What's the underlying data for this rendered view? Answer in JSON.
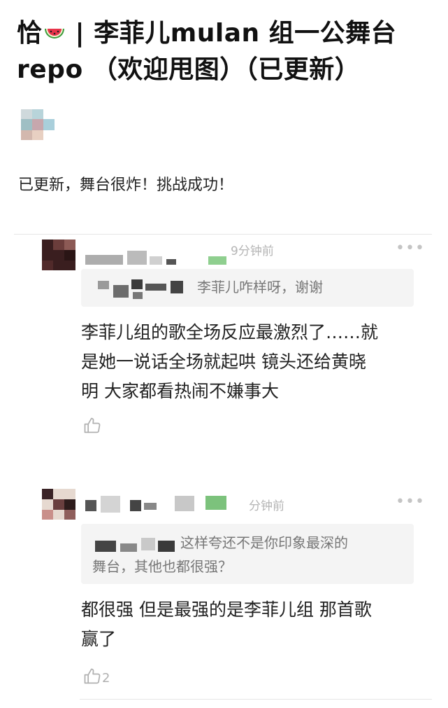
{
  "post": {
    "title": "恰🍉 | 李菲儿mulan 组一公舞台repo （欢迎甩图）（已更新）",
    "title_line1_prefix": "恰",
    "title_line1_rest": " | 李菲儿mulan 组一公舞台",
    "title_line2": "repo （欢迎甩图）（已更新）",
    "body": "已更新，舞台很炸！挑战成功！"
  },
  "comments": [
    {
      "time": "9分钟前",
      "quote": "李菲儿咋样呀，谢谢",
      "body_lines": [
        "李菲儿组的歌全场反应最激烈了……就",
        "是她一说话全场就起哄 镜头还给黄晓",
        "明 大家都看热闹不嫌事大"
      ],
      "likes": ""
    },
    {
      "time": "分钟前",
      "quote_line1": "这样夸还不是你印象最深的",
      "quote_line2": "舞台，其他也都很强？",
      "body_lines": [
        "都很强 但是最强的是李菲儿组 那首歌",
        "赢了"
      ],
      "likes": "2"
    }
  ],
  "icons": {
    "more": "more-dots-icon",
    "like": "thumbs-up-icon",
    "emoji": "watermelon-icon"
  },
  "colors": {
    "text": "#222222",
    "muted": "#b5b5b5",
    "quote_bg": "#f4f4f4",
    "divider": "#e6e6e6"
  }
}
